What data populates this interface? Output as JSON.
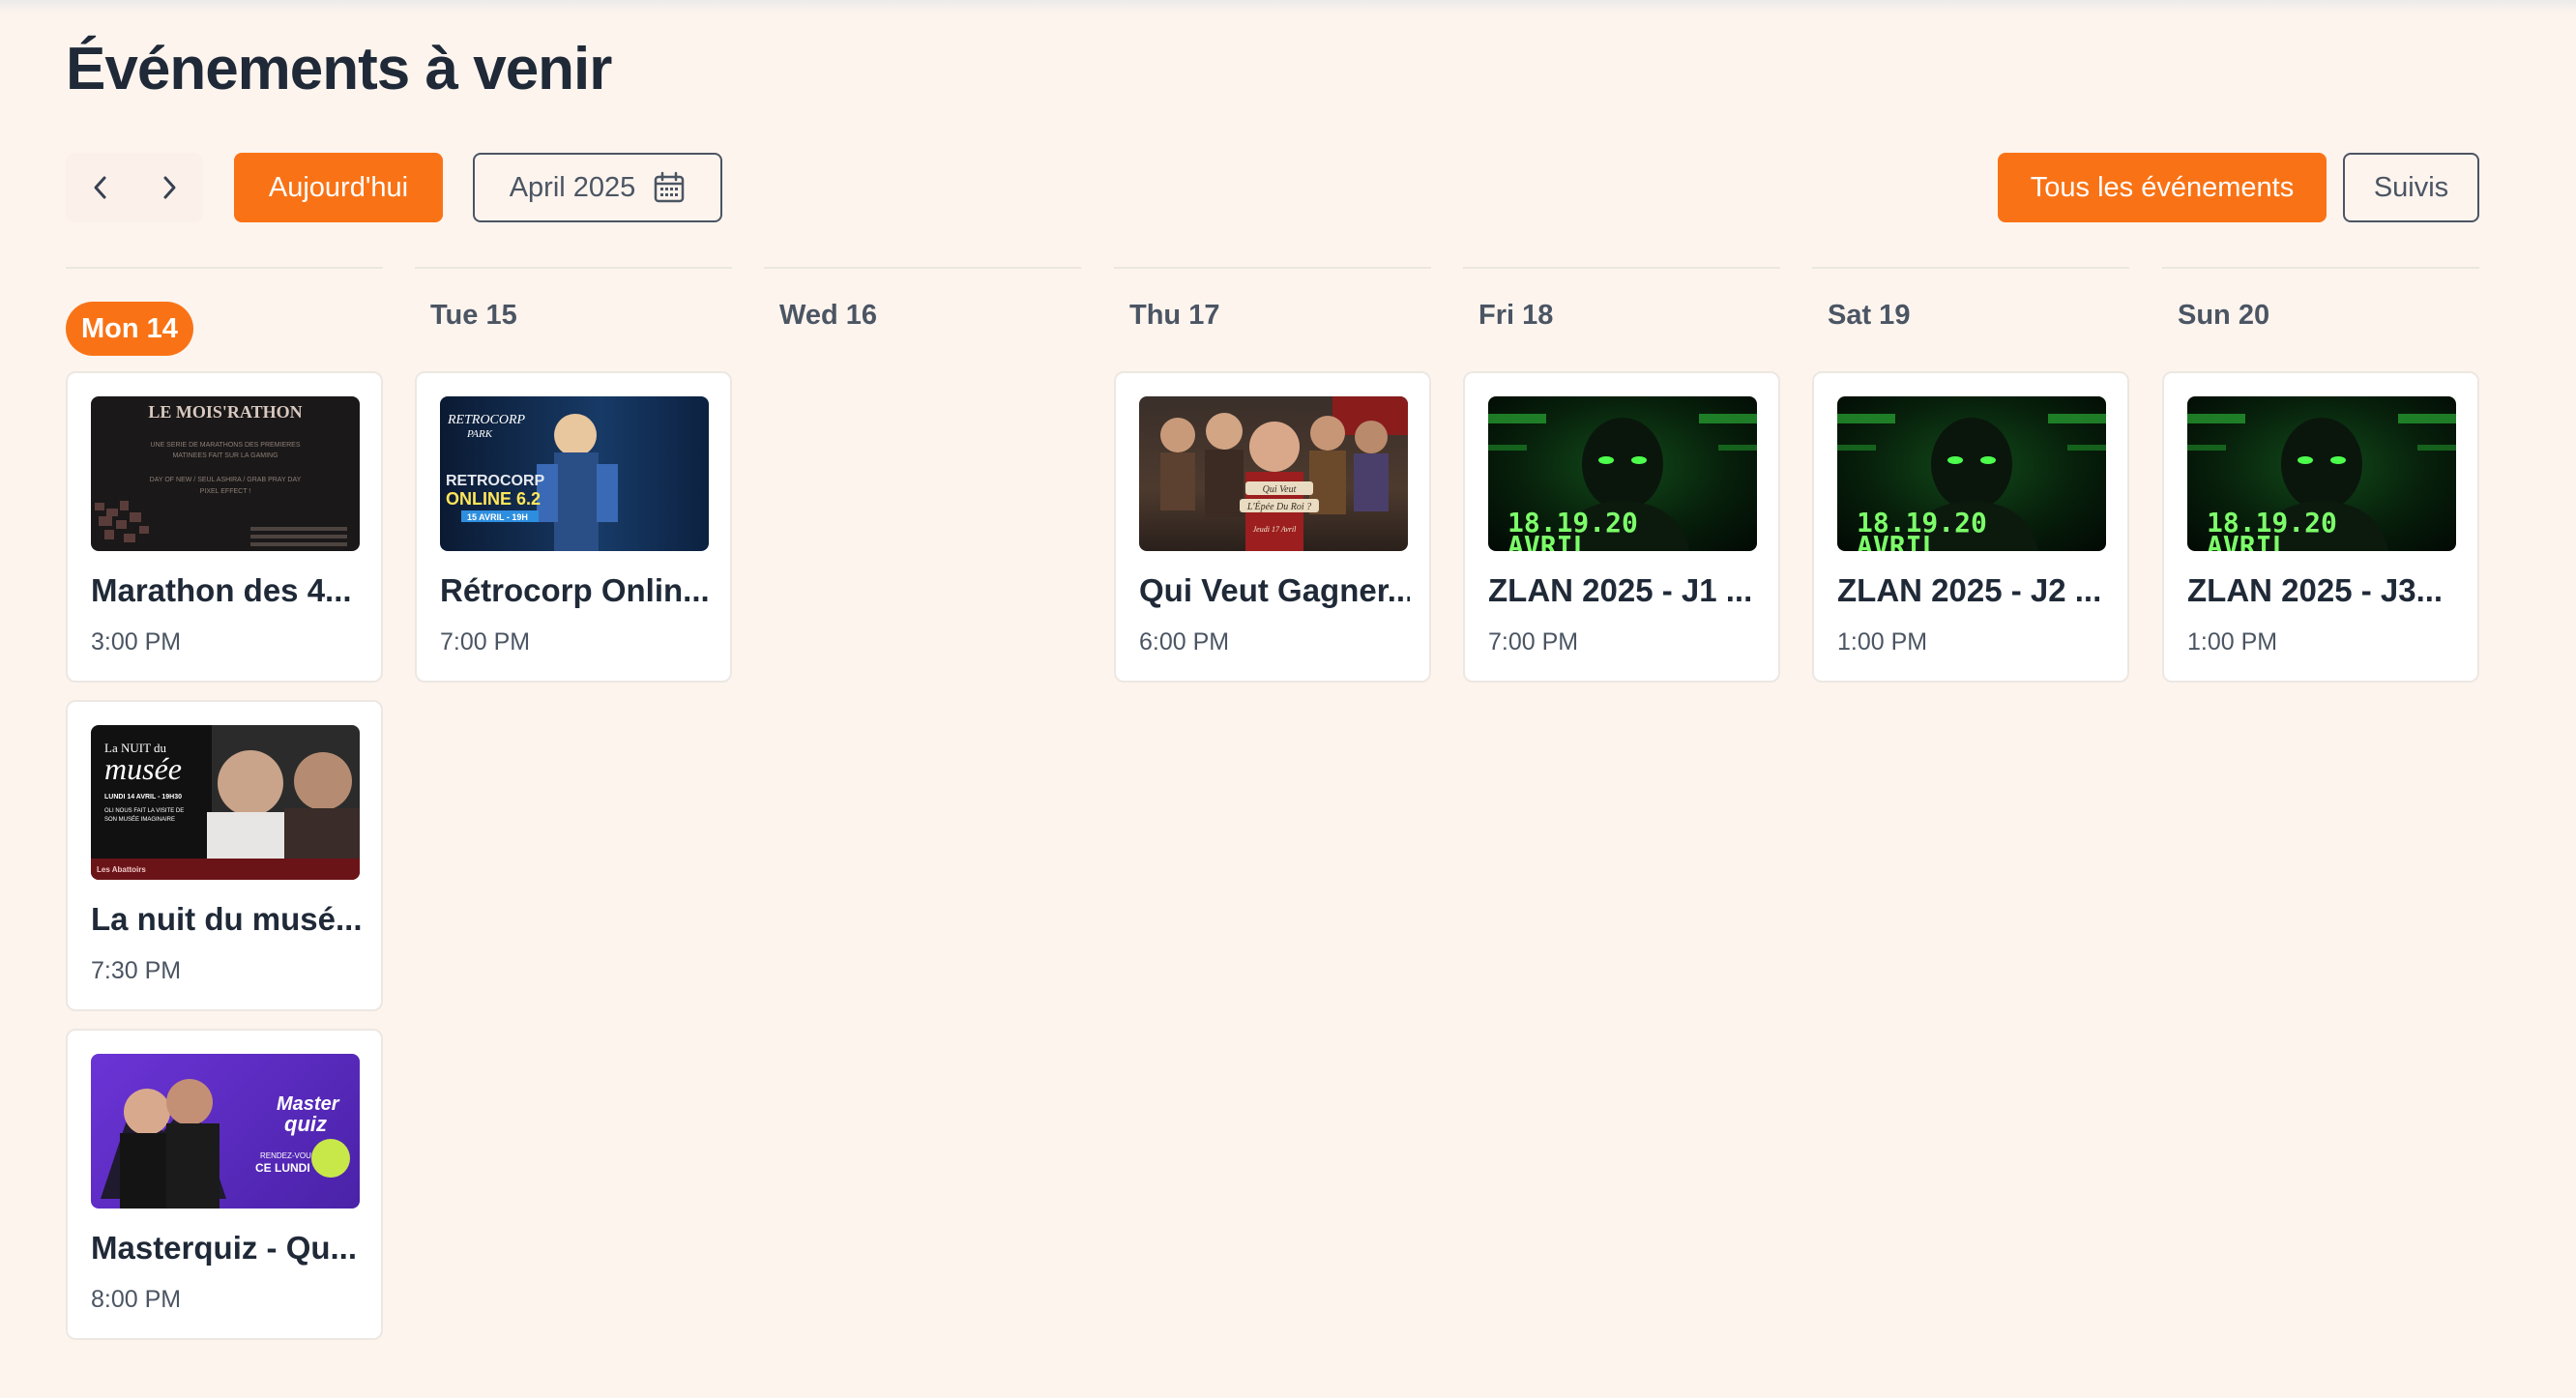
{
  "header": {
    "title": "Événements à venir"
  },
  "toolbar": {
    "prev_icon": "chevron-left-icon",
    "next_icon": "chevron-right-icon",
    "today_label": "Aujourd'hui",
    "month_label": "April 2025",
    "calendar_icon": "calendar-icon",
    "all_events_label": "Tous les événements",
    "followed_label": "Suivis"
  },
  "colors": {
    "accent": "#f97316",
    "background": "#fdf4ee",
    "card": "#ffffff",
    "text": "#1f2937",
    "muted": "#4b5563"
  },
  "days": [
    {
      "label": "Mon 14",
      "is_today": true,
      "events": [
        {
          "title": "Marathon des 4...",
          "time": "3:00 PM",
          "image": {
            "t1": "LE MOIS'RATHON",
            "t2": "UNE SERIE DE MARATHONS DES PREMIERES",
            "t3": "MATINEES FAIT SUR LA GAMING",
            "t4": "DAY OF NEW / SEUL ASHIRA / GRAB PRAY DAY",
            "t5": "PIXEL EFFECT !"
          }
        },
        {
          "title": "La nuit du musé...",
          "time": "7:30 PM",
          "image": {
            "t1": "La NUIT du",
            "t2": "musée",
            "t3": "LUNDI 14 AVRIL - 19H30",
            "t4": "OLI NOUS FAIT LA VISITE DE",
            "t5": "SON MUSÉE IMAGINAIRE",
            "t6": "Les Abattoirs"
          }
        },
        {
          "title": "Masterquiz - Qu...",
          "time": "8:00 PM",
          "image": {
            "t1": "Master",
            "t2": "quiz",
            "t3": "RENDEZ-VOUS",
            "t4": "CE LUNDI"
          }
        }
      ]
    },
    {
      "label": "Tue 15",
      "is_today": false,
      "events": [
        {
          "title": "Rétrocorp Onlin...",
          "time": "7:00 PM",
          "image": {
            "t1": "RETROCORP",
            "t2": "PARK",
            "t3": "RETROCORP",
            "t4": "ONLINE 6.2",
            "t5": "15 AVRIL - 19H"
          }
        }
      ]
    },
    {
      "label": "Wed 16",
      "is_today": false,
      "events": []
    },
    {
      "label": "Thu 17",
      "is_today": false,
      "events": [
        {
          "title": "Qui Veut Gagner...",
          "time": "6:00 PM",
          "image": {
            "t1": "Qui Veut",
            "t2": "L'Épée Du Roi ?",
            "t3": "Jeudi 17 Avril"
          }
        }
      ]
    },
    {
      "label": "Fri 18",
      "is_today": false,
      "events": [
        {
          "title": "ZLAN 2025 - J1 ...",
          "time": "7:00 PM",
          "image": {
            "t1": "18.19.20",
            "t2": "AVRIL"
          }
        }
      ]
    },
    {
      "label": "Sat 19",
      "is_today": false,
      "events": [
        {
          "title": "ZLAN 2025 - J2 ...",
          "time": "1:00 PM",
          "image": {
            "t1": "18.19.20",
            "t2": "AVRIL"
          }
        }
      ]
    },
    {
      "label": "Sun 20",
      "is_today": false,
      "events": [
        {
          "title": "ZLAN 2025 - J3...",
          "time": "1:00 PM",
          "image": {
            "t1": "18.19.20",
            "t2": "AVRIL"
          }
        }
      ]
    }
  ]
}
